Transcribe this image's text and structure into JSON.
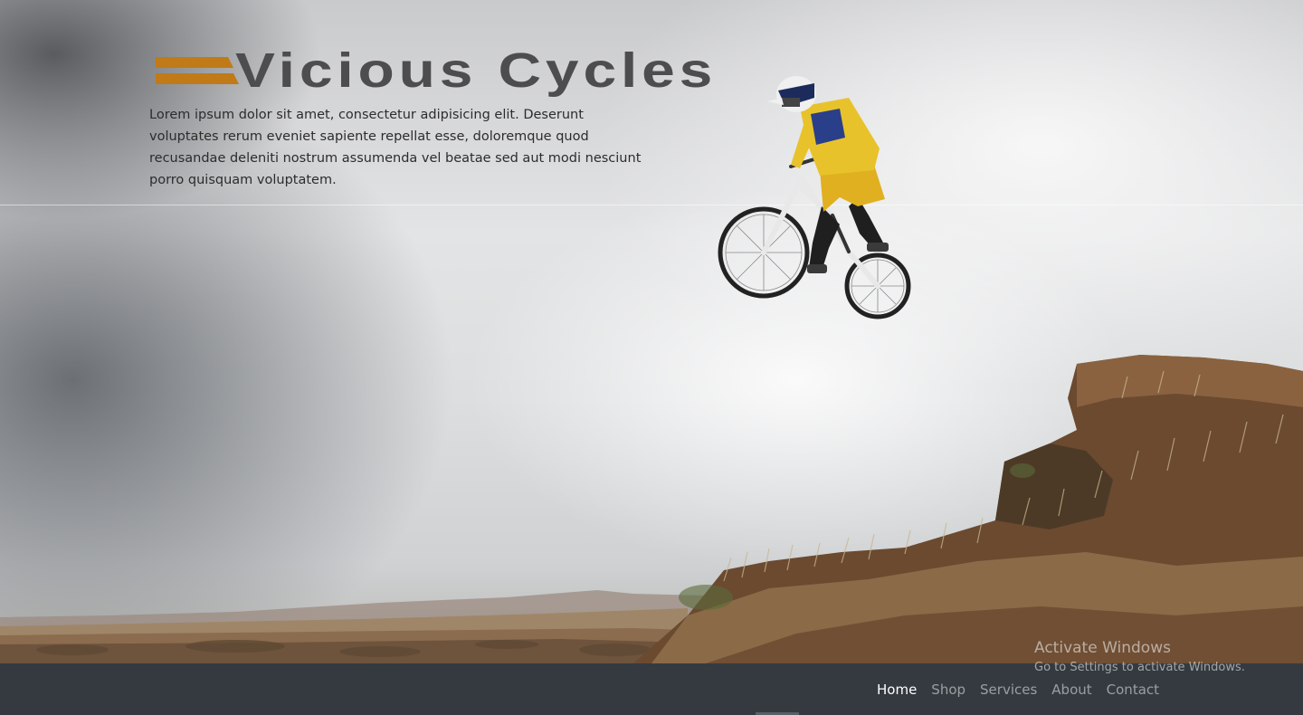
{
  "brand": {
    "name": "Vicious Cycles",
    "mark_color": "#c07a18",
    "text_color": "#4d4d4f"
  },
  "hero": {
    "intro": "Lorem ipsum dolor sit amet, consectetur adipisicing elit. Deserunt voluptates rerum eveniet sapiente repellat esse, doloremque quod recusandae deleniti nostrum assumenda vel beatae sed aut modi nesciunt porro quisquam voluptatem."
  },
  "nav": {
    "items": [
      {
        "label": "Home",
        "active": true
      },
      {
        "label": "Shop",
        "active": false
      },
      {
        "label": "Services",
        "active": false
      },
      {
        "label": "About",
        "active": false
      },
      {
        "label": "Contact",
        "active": false
      }
    ],
    "background": "#343a40"
  },
  "os_watermark": {
    "title": "Activate Windows",
    "subtitle": "Go to Settings to activate Windows."
  }
}
